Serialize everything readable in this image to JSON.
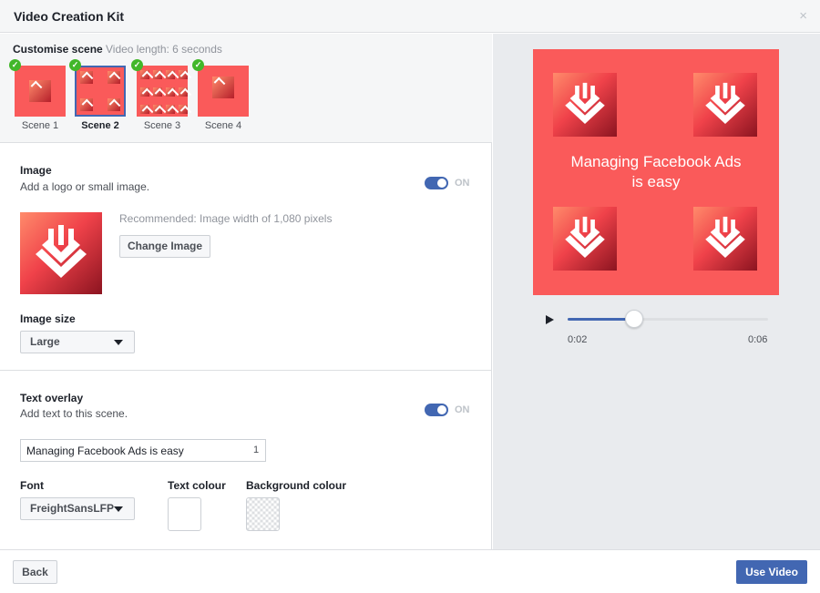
{
  "header": {
    "title": "Video Creation Kit",
    "close_icon": "×"
  },
  "scenes": {
    "label": "Customise scene",
    "video_length": "Video length: 6 seconds",
    "items": [
      {
        "label": "Scene 1",
        "complete": true,
        "selected": false
      },
      {
        "label": "Scene 2",
        "complete": true,
        "selected": true
      },
      {
        "label": "Scene 3",
        "complete": true,
        "selected": false
      },
      {
        "label": "Scene 4",
        "complete": true,
        "selected": false
      }
    ]
  },
  "image_section": {
    "heading": "Image",
    "description": "Add a logo or small image.",
    "toggle_label": "ON",
    "recommended": "Recommended: Image width of 1,080 pixels",
    "change_button": "Change Image",
    "size_label": "Image size",
    "size_value": "Large"
  },
  "text_section": {
    "heading": "Text overlay",
    "description": "Add text to this scene.",
    "toggle_label": "ON",
    "text_value": "Managing Facebook Ads is easy",
    "text_count": "1",
    "font_label": "Font",
    "font_value": "FreightSansLFP",
    "text_colour_label": "Text colour",
    "text_colour": "#ffffff",
    "background_colour_label": "Background colour"
  },
  "preview": {
    "overlay_line1": "Managing Facebook Ads",
    "overlay_line2": "is easy",
    "background": "#fa5a5a",
    "current_time": "0:02",
    "total_time": "0:06",
    "progress": 0.33
  },
  "footer": {
    "back_label": "Back",
    "use_label": "Use Video"
  },
  "colors": {
    "accent": "#4267b2",
    "success": "#42b72a",
    "brand_red": "#fa5a5a"
  }
}
